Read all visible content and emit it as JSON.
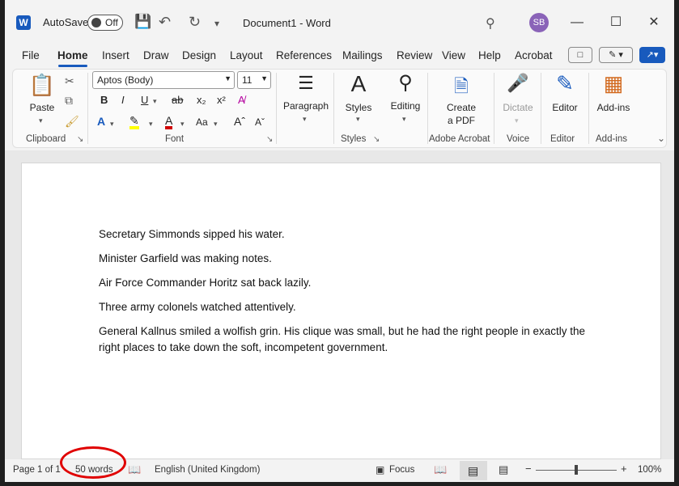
{
  "titlebar": {
    "app_letter": "W",
    "autosave_label": "AutoSave",
    "autosave_state": "Off",
    "doc_title": "Document1  -  Word",
    "avatar_initials": "SB"
  },
  "tabs": [
    "File",
    "Home",
    "Insert",
    "Draw",
    "Design",
    "Layout",
    "References",
    "Mailings",
    "Review",
    "View",
    "Help",
    "Acrobat"
  ],
  "active_tab": "Home",
  "ribbon": {
    "clipboard": {
      "paste": "Paste",
      "group": "Clipboard"
    },
    "font": {
      "name": "Aptos (Body)",
      "size": "11",
      "group": "Font"
    },
    "paragraph": {
      "label": "Paragraph"
    },
    "styles": {
      "label": "Styles",
      "group": "Styles"
    },
    "editing": {
      "label": "Editing"
    },
    "acrobat": {
      "label1": "Create",
      "label2": "a PDF",
      "group": "Adobe Acrobat"
    },
    "voice": {
      "label": "Dictate",
      "group": "Voice"
    },
    "editor": {
      "label": "Editor",
      "group": "Editor"
    },
    "addins": {
      "label": "Add-ins",
      "group": "Add-ins"
    }
  },
  "document": {
    "paragraphs": [
      "Secretary Simmonds sipped his water.",
      "Minister Garfield was making notes.",
      "Air Force Commander Horitz sat back lazily.",
      "Three army colonels watched attentively.",
      "General Kallnus smiled a wolfish grin. His clique was small, but he had the right people in exactly the right places to take down the soft, incompetent government."
    ]
  },
  "statusbar": {
    "page": "Page 1 of 1",
    "words": "50 words",
    "language": "English (United Kingdom)",
    "focus": "Focus",
    "zoom": "100%",
    "zoom_level": 1.0
  },
  "colors": {
    "accent": "#185abd",
    "annotation": "#e00000"
  }
}
